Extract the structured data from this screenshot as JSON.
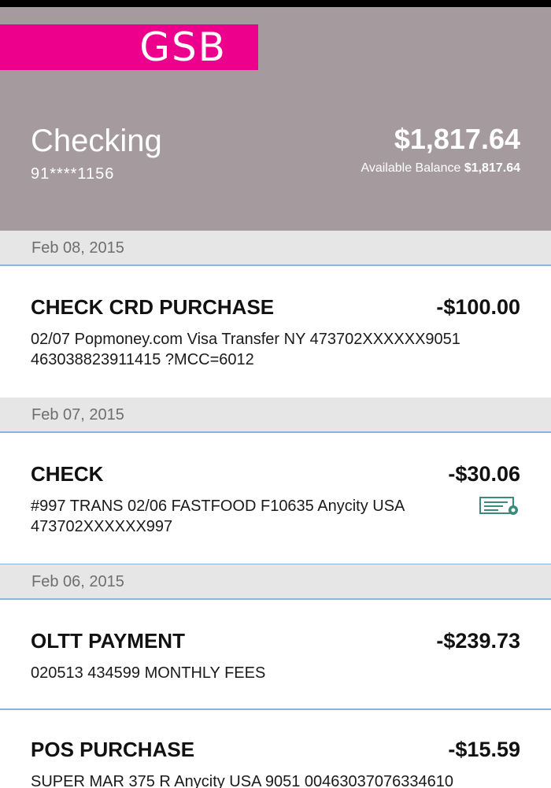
{
  "app": {
    "logo_text": "GSB",
    "brand_color": "#ec008c",
    "header_color": "#a59b9f",
    "divider_color": "#8fb2dc"
  },
  "account": {
    "name": "Checking",
    "number": "91****1156",
    "balance": "$1,817.64",
    "available_label": "Available Balance",
    "available_value": "$1,817.64"
  },
  "groups": [
    {
      "date": "Feb 08, 2015",
      "transactions": [
        {
          "title": "CHECK CRD PURCHASE",
          "amount": "-$100.00",
          "description": "02/07 Popmoney.com Visa Transfer NY 473702XXXXXX9051 463038823911415 ?MCC=6012"
        }
      ]
    },
    {
      "date": "Feb 07, 2015",
      "transactions": [
        {
          "title": "CHECK",
          "amount": "-$30.06",
          "description": "#997 TRANS 02/06 FASTFOOD F10635 Anycity USA 473702XXXXXX997",
          "icon": "check-image-icon"
        }
      ]
    },
    {
      "date": "Feb 06, 2015",
      "transactions": [
        {
          "title": "OLTT PAYMENT",
          "amount": "-$239.73",
          "description": "020513 434599 MONTHLY FEES"
        },
        {
          "title": "POS PURCHASE",
          "amount": "-$15.59",
          "description": "SUPER MAR 375 R Anycity USA 9051 00463037076334610"
        }
      ]
    }
  ]
}
